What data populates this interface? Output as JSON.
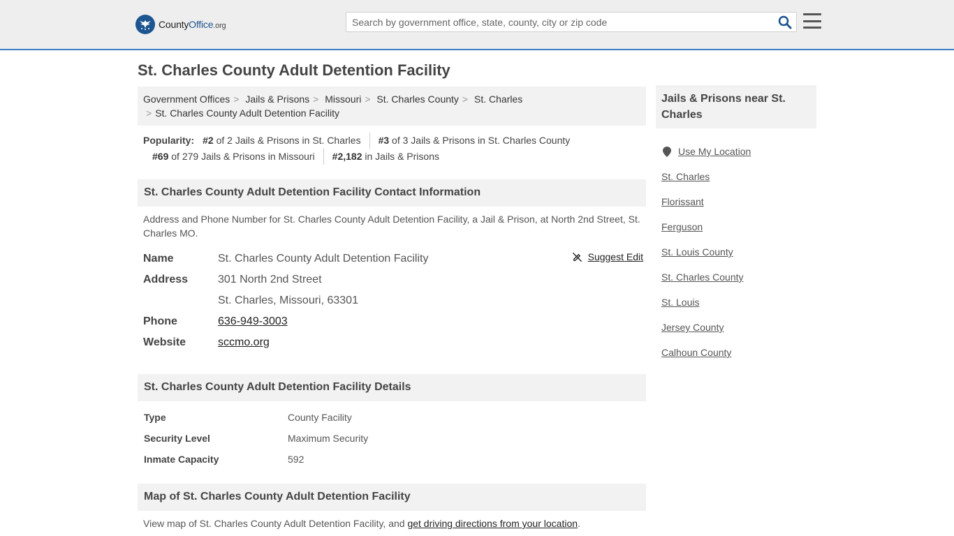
{
  "header": {
    "logo_main": "County",
    "logo_accent": "Office",
    "logo_tld": ".org",
    "search_placeholder": "Search by government office, state, county, city or zip code"
  },
  "page": {
    "title": "St. Charles County Adult Detention Facility"
  },
  "breadcrumb": {
    "items": [
      "Government Offices",
      "Jails & Prisons",
      "Missouri",
      "St. Charles County",
      "St. Charles",
      "St. Charles County Adult Detention Facility"
    ]
  },
  "popularity": {
    "label": "Popularity:",
    "items": [
      {
        "rank": "#2",
        "text": " of 2 Jails & Prisons in St. Charles"
      },
      {
        "rank": "#3",
        "text": " of 3 Jails & Prisons in St. Charles County"
      },
      {
        "rank": "#69",
        "text": " of 279 Jails & Prisons in Missouri"
      },
      {
        "rank": "#2,182",
        "text": " in Jails & Prisons"
      }
    ]
  },
  "contact": {
    "heading": "St. Charles County Adult Detention Facility Contact Information",
    "description": "Address and Phone Number for St. Charles County Adult Detention Facility, a Jail & Prison, at North 2nd Street, St. Charles MO.",
    "suggest_edit": "Suggest Edit",
    "name_label": "Name",
    "name_value": "St. Charles County Adult Detention Facility",
    "address_label": "Address",
    "address_line1": "301 North 2nd Street",
    "address_line2": "St. Charles, Missouri, 63301",
    "phone_label": "Phone",
    "phone_value": "636-949-3003",
    "website_label": "Website",
    "website_value": "sccmo.org"
  },
  "details": {
    "heading": "St. Charles County Adult Detention Facility Details",
    "rows": [
      {
        "key": "Type",
        "value": "County Facility"
      },
      {
        "key": "Security Level",
        "value": "Maximum Security"
      },
      {
        "key": "Inmate Capacity",
        "value": "592"
      }
    ]
  },
  "map": {
    "heading": "Map of St. Charles County Adult Detention Facility",
    "desc_prefix": "View map of St. Charles County Adult Detention Facility, and ",
    "desc_link": "get driving directions from your location",
    "desc_suffix": "."
  },
  "sidebar": {
    "heading": "Jails & Prisons near St. Charles",
    "use_location": "Use My Location",
    "links": [
      "St. Charles",
      "Florissant",
      "Ferguson",
      "St. Louis County",
      "St. Charles County",
      "St. Louis",
      "Jersey County",
      "Calhoun County"
    ]
  },
  "colors": {
    "brand": "#1d5590",
    "header_border": "#3b7fc4",
    "search_icon": "#1d5590"
  }
}
